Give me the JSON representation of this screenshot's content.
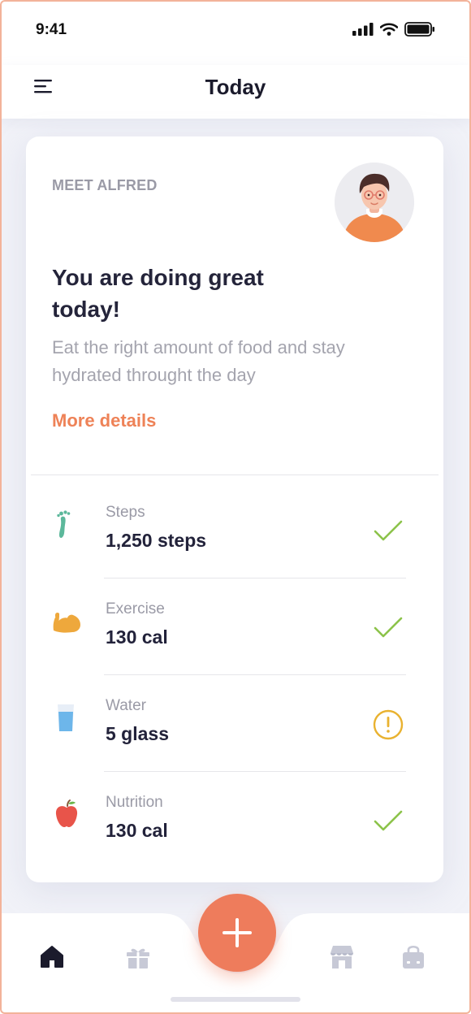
{
  "status_bar": {
    "time": "9:41"
  },
  "header": {
    "title": "Today"
  },
  "card": {
    "eyebrow": "MEET ALFRED",
    "headline": "You are doing great today!",
    "description": "Eat the right amount of food and stay hydrated throught the day",
    "link": "More details"
  },
  "metrics": [
    {
      "label": "Steps",
      "value": "1,250 steps",
      "icon": "footprint-icon",
      "state": "check-icon"
    },
    {
      "label": "Exercise",
      "value": "130 cal",
      "icon": "flexed-arm-icon",
      "state": "check-icon"
    },
    {
      "label": "Water",
      "value": "5 glass",
      "icon": "water-glass-icon",
      "state": "warning-icon"
    },
    {
      "label": "Nutrition",
      "value": "130 cal",
      "icon": "apple-icon",
      "state": "check-icon"
    }
  ],
  "tabbar": {
    "tabs": [
      "home-icon",
      "gift-icon",
      "store-icon",
      "bag-icon"
    ],
    "fab": "plus-icon"
  },
  "colors": {
    "accent": "#ee7c5c",
    "link": "#ee8257",
    "success": "#8cc34a",
    "warning": "#e9b230"
  }
}
